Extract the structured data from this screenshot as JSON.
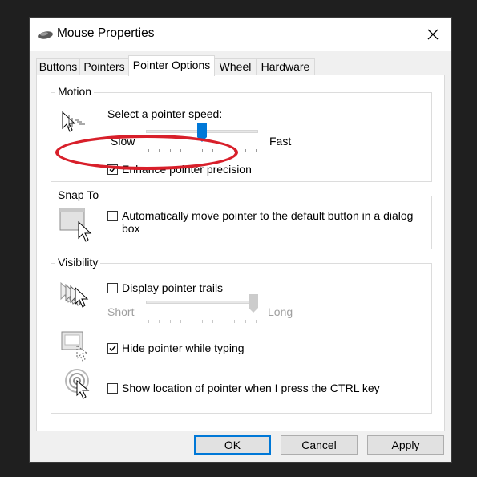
{
  "window": {
    "title": "Mouse Properties",
    "title_icon": "mouse-icon",
    "close_icon": "close-icon"
  },
  "tabs": [
    {
      "label": "Buttons",
      "active": false
    },
    {
      "label": "Pointers",
      "active": false
    },
    {
      "label": "Pointer Options",
      "active": true
    },
    {
      "label": "Wheel",
      "active": false
    },
    {
      "label": "Hardware",
      "active": false
    }
  ],
  "motion": {
    "group_label": "Motion",
    "speed_prompt": "Select a pointer speed:",
    "slow_label": "Slow",
    "fast_label": "Fast",
    "speed_level": 0.5,
    "enhance_precision": {
      "label": "Enhance pointer precision",
      "checked": true
    },
    "icon": "pointer-speed-icon"
  },
  "snap_to": {
    "group_label": "Snap To",
    "auto_move": {
      "label_line1": "Automatically move pointer to the default button in a dialog",
      "label_line2": "box",
      "checked": false
    },
    "icon": "snap-to-icon"
  },
  "visibility": {
    "group_label": "Visibility",
    "trails": {
      "label": "Display pointer trails",
      "checked": false,
      "short_label": "Short",
      "long_label": "Long",
      "trail_level": 1.0,
      "icon": "pointer-trails-icon"
    },
    "hide_typing": {
      "label": "Hide pointer while typing",
      "checked": true,
      "icon": "hide-pointer-icon"
    },
    "show_location": {
      "label": "Show location of pointer when I press the CTRL key",
      "checked": false,
      "icon": "pointer-location-icon"
    }
  },
  "buttons": {
    "ok": "OK",
    "cancel": "Cancel",
    "apply": "Apply"
  },
  "annotation": {
    "highlight_color": "#d81f2a"
  },
  "colors": {
    "accent": "#0078d7"
  }
}
